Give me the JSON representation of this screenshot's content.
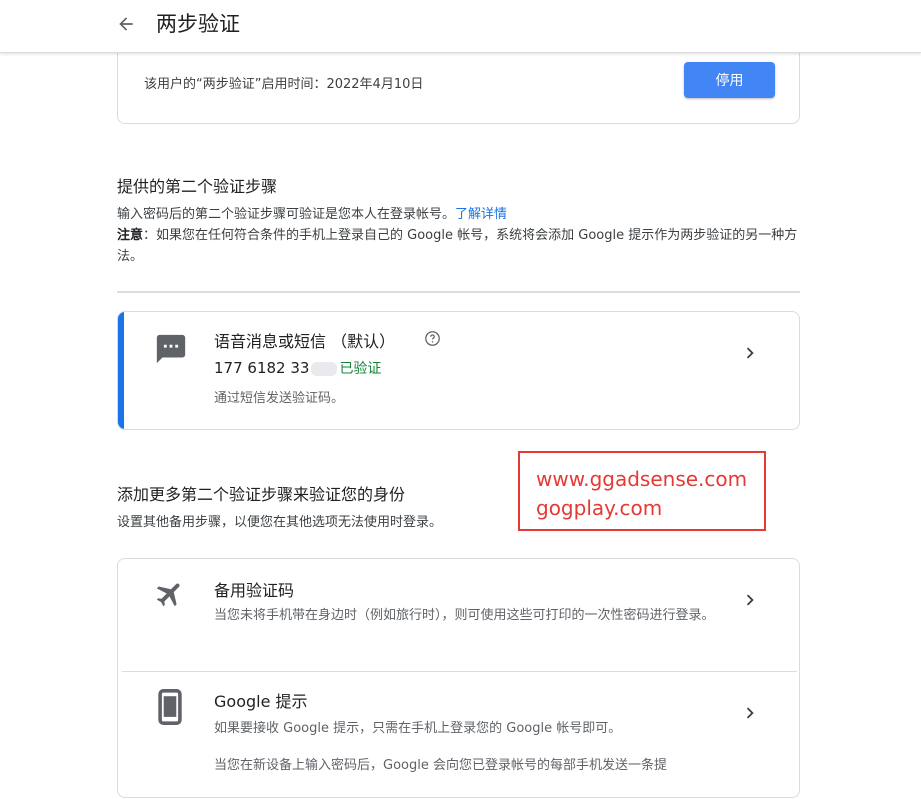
{
  "header": {
    "title": "两步验证"
  },
  "status": {
    "text": "该用户的“两步验证”启用时间：2022年4月10日",
    "disable_label": "停用"
  },
  "second_step": {
    "heading": "提供的第二个验证步骤",
    "desc": "输入密码后的第二个验证步骤可验证是您本人在登录帐号。",
    "learn_more": "了解详情",
    "note_label": "注意",
    "note_text": "：如果您在任何符合条件的手机上登录自己的 Google 帐号，系统将会添加 Google 提示作为两步验证的另一种方法。"
  },
  "voice_sms": {
    "title": "语音消息或短信 （默认）",
    "phone": "177 6182 33",
    "verified": "已验证",
    "sub": "通过短信发送验证码。"
  },
  "watermark": {
    "line1": "www.ggadsense.com",
    "line2": "gogplay.com"
  },
  "add_more": {
    "heading": "添加更多第二个验证步骤来验证您的身份",
    "desc": "设置其他备用步骤，以便您在其他选项无法使用时登录。"
  },
  "options": [
    {
      "title": "备用验证码",
      "desc": "当您未将手机带在身边时（例如旅行时），则可使用这些可打印的一次性密码进行登录。"
    },
    {
      "title": "Google 提示",
      "desc1": "如果要接收 Google 提示，只需在手机上登录您的 Google 帐号即可。",
      "desc2": "当您在新设备上输入密码后，Google 会向您已登录帐号的每部手机发送一条提"
    }
  ],
  "colors": {
    "accent": "#1a73e8",
    "button": "#4285f4",
    "verified": "#188038",
    "watermark": "#e53935"
  },
  "icons": [
    "back-arrow-icon",
    "sms-icon",
    "help-icon",
    "chevron-right-icon",
    "airplane-icon",
    "phone-icon"
  ]
}
